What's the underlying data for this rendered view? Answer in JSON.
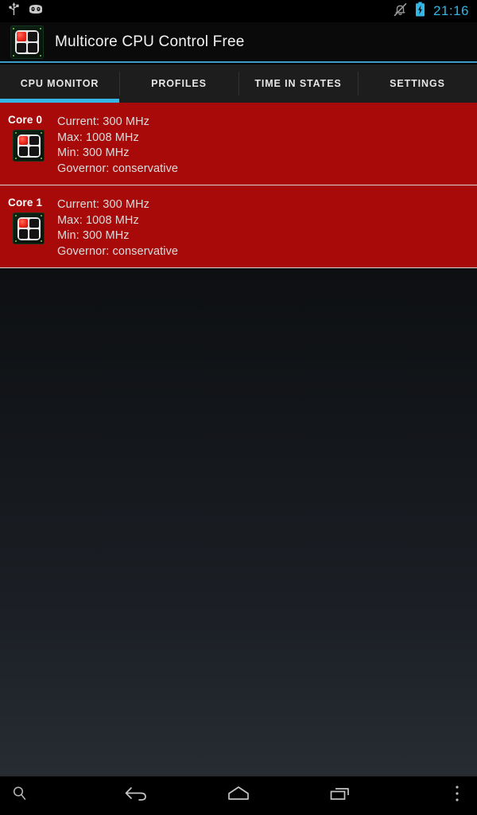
{
  "statusbar": {
    "left_icons": [
      {
        "name": "usb-icon",
        "label": "USB connected"
      },
      {
        "name": "cyanogenmod-icon",
        "label": "CyanogenMod"
      }
    ],
    "right_icons": [
      {
        "name": "silent-mode-icon",
        "label": "Silent / vibrate off"
      },
      {
        "name": "battery-charging-icon",
        "label": "Battery charging"
      }
    ],
    "clock": "21:16",
    "clock_color": "#33b5e5"
  },
  "titlebar": {
    "app_icon": "cpu-chip-icon",
    "title": "Multicore CPU Control Free",
    "accent_color": "#3b9fc4"
  },
  "tabs": [
    {
      "label": "CPU MONITOR",
      "active": true
    },
    {
      "label": "PROFILES",
      "active": false
    },
    {
      "label": "TIME IN STATES",
      "active": false
    },
    {
      "label": "SETTINGS",
      "active": false
    }
  ],
  "tab_indicator_color": "#33b5e5",
  "cores_panel": {
    "background_color": "#a80a0a",
    "cores": [
      {
        "name": "Core 0",
        "icon": "cpu-chip-icon",
        "current": "Current: 300 MHz",
        "max": "Max: 1008 MHz",
        "min": "Min: 300 MHz",
        "governor": "Governor: conservative"
      },
      {
        "name": "Core 1",
        "icon": "cpu-chip-icon",
        "current": "Current: 300 MHz",
        "max": "Max: 1008 MHz",
        "min": "Min: 300 MHz",
        "governor": "Governor: conservative"
      }
    ]
  },
  "navbar": [
    {
      "name": "search-button",
      "icon": "search-icon"
    },
    {
      "name": "back-button",
      "icon": "back-arrow-icon"
    },
    {
      "name": "home-button",
      "icon": "home-icon"
    },
    {
      "name": "recents-button",
      "icon": "recents-icon"
    },
    {
      "name": "overflow-menu-button",
      "icon": "more-vertical-icon"
    }
  ]
}
